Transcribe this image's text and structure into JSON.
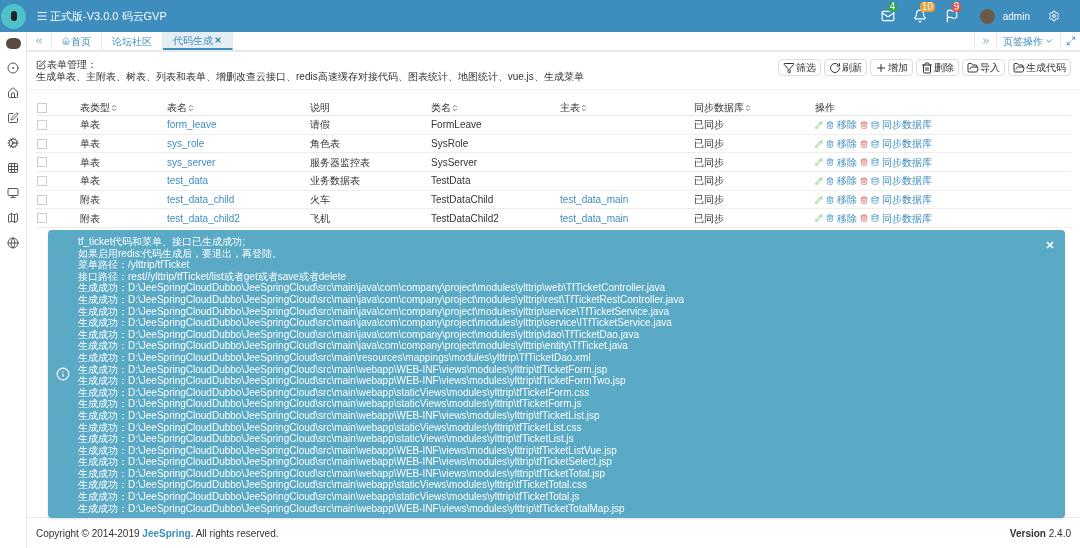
{
  "topbar": {
    "title": "正式版-V3.0.0 码云GVP",
    "badges": [
      {
        "kind": "mail",
        "count": "4",
        "color": "#2ea44f"
      },
      {
        "kind": "bell",
        "count": "10",
        "color": "#e6a23c"
      },
      {
        "kind": "flag",
        "count": "9",
        "color": "#d9534f"
      }
    ],
    "user": "admin"
  },
  "tabs": [
    {
      "label": "首页",
      "kind": "home",
      "selected": false
    },
    {
      "label": "论坛社区",
      "kind": "plain",
      "selected": false
    },
    {
      "label": "代码生成",
      "kind": "closable",
      "selected": true
    }
  ],
  "tab_menu": "页签操作",
  "panel": {
    "title": "表单管理：",
    "subtitle": "生成单表、主附表、树表、列表和表单、增删改查云接口、redis高速缓存对接代码、图表统计、地图统计、vue.js、生成菜单"
  },
  "toolbar": [
    {
      "kind": "filter",
      "label": "筛选"
    },
    {
      "kind": "refresh",
      "label": "刷新"
    },
    {
      "kind": "add",
      "label": "增加"
    },
    {
      "kind": "delete",
      "label": "删除"
    },
    {
      "kind": "import",
      "label": "导入"
    },
    {
      "kind": "import",
      "label": "生成代码"
    }
  ],
  "table": {
    "select_all_checked": false,
    "columns": [
      {
        "label": "表类型",
        "sortable": true
      },
      {
        "label": "表名",
        "sortable": true
      },
      {
        "label": "说明",
        "sortable": false
      },
      {
        "label": "类名",
        "sortable": true
      },
      {
        "label": "主表",
        "sortable": true
      },
      {
        "label": "同步数据库",
        "sortable": true
      },
      {
        "label": "操作",
        "sortable": false
      }
    ],
    "rows": [
      {
        "checked": false,
        "cells": [
          "单表",
          "form_leave",
          "请假",
          "FormLeave",
          "",
          "已同步"
        ],
        "actions": [
          "移除",
          "同步数据库"
        ]
      },
      {
        "checked": false,
        "cells": [
          "单表",
          "sys_role",
          "角色表",
          "SysRole",
          "",
          "已同步"
        ],
        "actions": [
          "移除",
          "同步数据库"
        ]
      },
      {
        "checked": false,
        "cells": [
          "单表",
          "sys_server",
          "服务器监控表",
          "SysServer",
          "",
          "已同步"
        ],
        "actions": [
          "移除",
          "同步数据库"
        ]
      },
      {
        "checked": false,
        "cells": [
          "单表",
          "test_data",
          "业务数据表",
          "TestData",
          "",
          "已同步"
        ],
        "actions": [
          "移除",
          "同步数据库"
        ]
      },
      {
        "checked": false,
        "cells": [
          "附表",
          "test_data_child",
          "火车",
          "TestDataChild",
          "test_data_main",
          "已同步"
        ],
        "actions": [
          "移除",
          "同步数据库"
        ]
      },
      {
        "checked": false,
        "cells": [
          "附表",
          "test_data_child2",
          "飞机",
          "TestDataChild2",
          "test_data_main",
          "已同步"
        ],
        "actions": [
          "移除",
          "同步数据库"
        ]
      }
    ]
  },
  "toast": {
    "lines": [
      "tf_ticket代码和菜单、接口已生成成功;",
      "如果启用redis:代码生成后，要退出，再登陆。",
      "菜单路径：/ylttrip/tfTicket",
      "接口路径：rest//ylttrip/tfTicket/list或者get或者save或者delete",
      "生成成功：D:\\JeeSpringCloudDubbo\\JeeSpringCloud\\src\\main\\java\\com\\company\\project\\modules\\ylttrip\\web\\TfTicketController.java",
      "生成成功：D:\\JeeSpringCloudDubbo\\JeeSpringCloud\\src\\main\\java\\com\\company\\project\\modules\\ylttrip\\rest\\TfTicketRestController.java",
      "生成成功：D:\\JeeSpringCloudDubbo\\JeeSpringCloud\\src\\main\\java\\com\\company\\project\\modules\\ylttrip\\service\\TfTicketService.java",
      "生成成功：D:\\JeeSpringCloudDubbo\\JeeSpringCloud\\src\\main\\java\\com\\company\\project\\modules\\ylttrip\\service\\ITfTicketService.java",
      "生成成功：D:\\JeeSpringCloudDubbo\\JeeSpringCloud\\src\\main\\java\\com\\company\\project\\modules\\ylttrip\\dao\\TfTicketDao.java",
      "生成成功：D:\\JeeSpringCloudDubbo\\JeeSpringCloud\\src\\main\\java\\com\\company\\project\\modules\\ylttrip\\entity\\TfTicket.java",
      "生成成功：D:\\JeeSpringCloudDubbo\\JeeSpringCloud\\src\\main\\resources\\mappings\\modules\\ylttrip\\TfTicketDao.xml",
      "生成成功：D:\\JeeSpringCloudDubbo\\JeeSpringCloud\\src\\main\\webapp\\WEB-INF\\views\\modules\\ylttrip\\tfTicketForm.jsp",
      "生成成功：D:\\JeeSpringCloudDubbo\\JeeSpringCloud\\src\\main\\webapp\\WEB-INF\\views\\modules\\ylttrip\\tfTicketFormTwo.jsp",
      "生成成功：D:\\JeeSpringCloudDubbo\\JeeSpringCloud\\src\\main\\webapp\\staticViews\\modules\\ylttrip\\tfTicketForm.css",
      "生成成功：D:\\JeeSpringCloudDubbo\\JeeSpringCloud\\src\\main\\webapp\\staticViews\\modules\\ylttrip\\tfTicketForm.js",
      "生成成功：D:\\JeeSpringCloudDubbo\\JeeSpringCloud\\src\\main\\webapp\\WEB-INF\\views\\modules\\ylttrip\\tfTicketList.jsp",
      "生成成功：D:\\JeeSpringCloudDubbo\\JeeSpringCloud\\src\\main\\webapp\\staticViews\\modules\\ylttrip\\tfTicketList.css",
      "生成成功：D:\\JeeSpringCloudDubbo\\JeeSpringCloud\\src\\main\\webapp\\staticViews\\modules\\ylttrip\\tfTicketList.js",
      "生成成功：D:\\JeeSpringCloudDubbo\\JeeSpringCloud\\src\\main\\webapp\\WEB-INF\\views\\modules\\ylttrip\\tfTicketListVue.jsp",
      "生成成功：D:\\JeeSpringCloudDubbo\\JeeSpringCloud\\src\\main\\webapp\\WEB-INF\\views\\modules\\ylttrip\\tfTicketSelect.jsp",
      "生成成功：D:\\JeeSpringCloudDubbo\\JeeSpringCloud\\src\\main\\webapp\\WEB-INF\\views\\modules\\ylttrip\\tfTicketTotal.jsp",
      "生成成功：D:\\JeeSpringCloudDubbo\\JeeSpringCloud\\src\\main\\webapp\\staticViews\\modules\\ylttrip\\tfTicketTotal.css",
      "生成成功：D:\\JeeSpringCloudDubbo\\JeeSpringCloud\\src\\main\\webapp\\staticViews\\modules\\ylttrip\\tfTicketTotal.js",
      "生成成功：D:\\JeeSpringCloudDubbo\\JeeSpringCloud\\src\\main\\webapp\\WEB-INF\\views\\modules\\ylttrip\\tfTicketTotalMap.jsp"
    ]
  },
  "footer": {
    "copyright": "Copyright © 2014-2019 ",
    "link": "JeeSpring.",
    "rights": " All rights reserved.",
    "version_label": "Version",
    "version": "2.4.0"
  }
}
